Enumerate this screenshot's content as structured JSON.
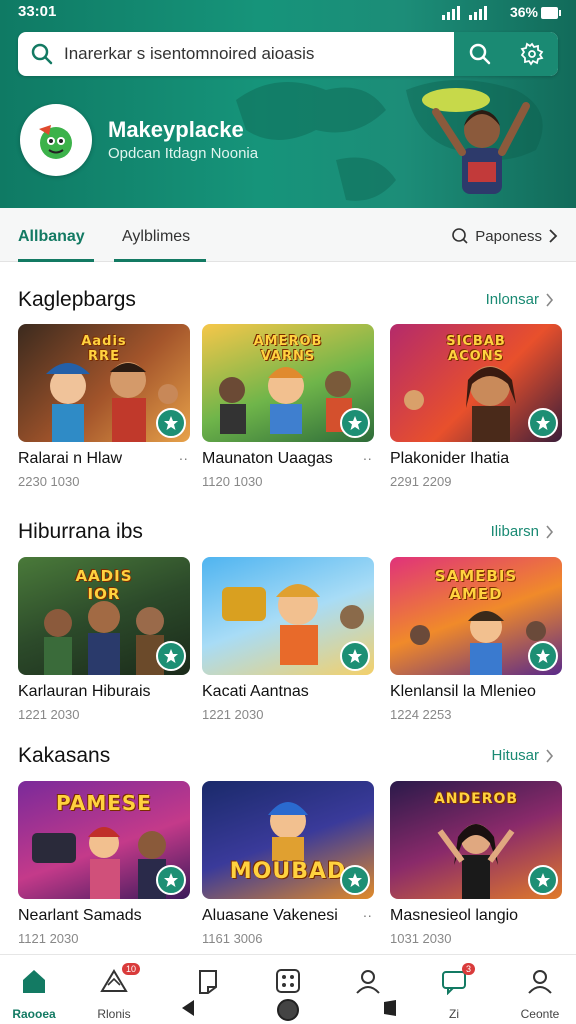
{
  "status_bar": {
    "time": "33:01",
    "battery": "36%"
  },
  "search": {
    "text": "Inarerkar s isentomnoired aioasis"
  },
  "app": {
    "name": "Makeyplacke",
    "tagline": "Opdcan Itdagn Noonia"
  },
  "tabs": [
    {
      "label": "Allbanay"
    },
    {
      "label": "Aylblimes"
    }
  ],
  "filter": {
    "label": "Paponess"
  },
  "sections": [
    {
      "title": "Kaglepbargs",
      "more": "Inlonsar",
      "cards": [
        {
          "title": "Ralarai n Hlaw",
          "meta": "2230 1030",
          "art": "Aadis\nRRE"
        },
        {
          "title": "Maunaton Uaagas",
          "meta": "1120 1030",
          "art": "AMEROB\nVARNS"
        },
        {
          "title": "Plakonider Ihatia",
          "meta": "2291 2209",
          "art": "SICBAB\nACONS"
        }
      ]
    },
    {
      "title": "Hiburrana ibs",
      "more": "Ilibarsn",
      "cards": [
        {
          "title": "Karlauran Hiburais",
          "meta": "1221 2030",
          "art": "AADIS\nIOR"
        },
        {
          "title": "Kacati Aantnas",
          "meta": "1221 2030",
          "art": ""
        },
        {
          "title": "Klenlansil la Mlenieo",
          "meta": "1224 2253",
          "art": "SAMEBIS\nAMED"
        }
      ]
    },
    {
      "title": "Kakasans",
      "more": "Hitusar",
      "cards": [
        {
          "title": "Nearlant Samads",
          "meta": "1121 2030",
          "art": "PAMESE"
        },
        {
          "title": "Aluasane Vakenesi",
          "meta": "1161 3006",
          "art": "MOUBAD"
        },
        {
          "title": "Masnesieol langio",
          "meta": "1031 2030",
          "art": "ANDEROB"
        }
      ]
    }
  ],
  "bottom_nav": [
    {
      "label": "Raooea",
      "icon": "home-icon",
      "active": true
    },
    {
      "label": "Rlonis",
      "icon": "triangle-icon",
      "badge": "10"
    },
    {
      "label": "",
      "icon": "document-icon"
    },
    {
      "label": "",
      "icon": "grid-icon"
    },
    {
      "label": "",
      "icon": "profile-icon"
    },
    {
      "label": "Zi",
      "icon": "chat-icon",
      "badge": "3"
    },
    {
      "label": "Ceonte",
      "icon": "account-icon"
    }
  ],
  "colors": {
    "brand": "#137a63",
    "accent": "#1d8f74"
  }
}
